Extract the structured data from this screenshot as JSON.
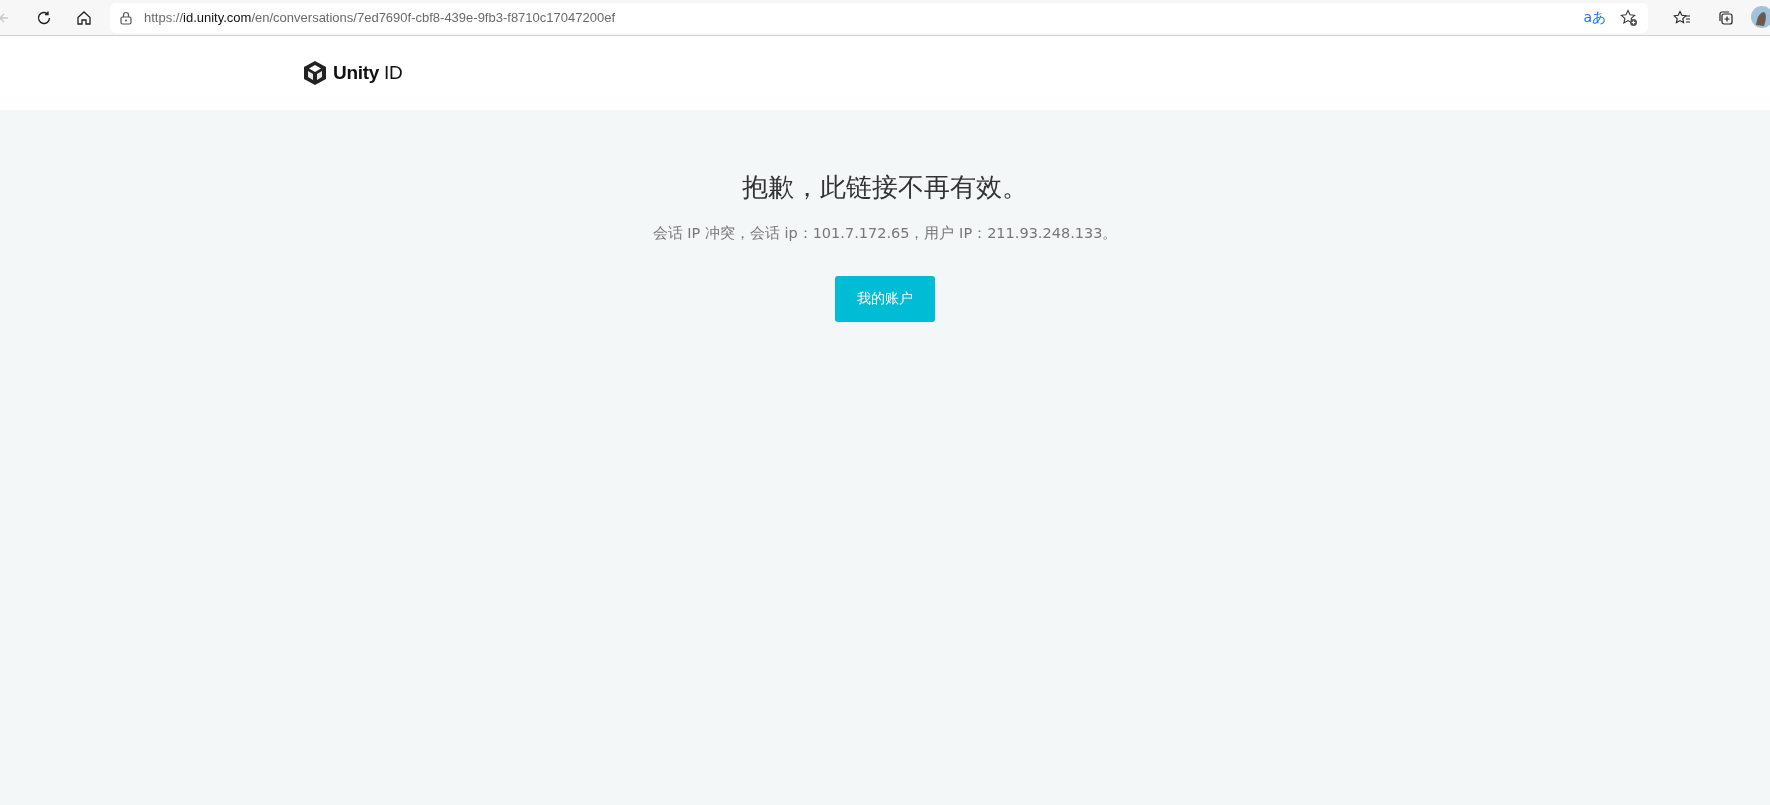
{
  "browser": {
    "back_disabled": true,
    "url": {
      "scheme": "https://",
      "host": "id.unity.com",
      "path": "/en/conversations/7ed7690f-cbf8-439e-9fb3-f8710c17047200ef"
    },
    "translate_label": "aあ"
  },
  "header": {
    "logo": "**Unity** ID"
  },
  "message": {
    "title": "抱歉，此链接不再有效。",
    "detail": "会话 IP 冲突，会话 ip：101.7.172.65，用户 IP：211.93.248.133。",
    "button": "我的账户"
  }
}
